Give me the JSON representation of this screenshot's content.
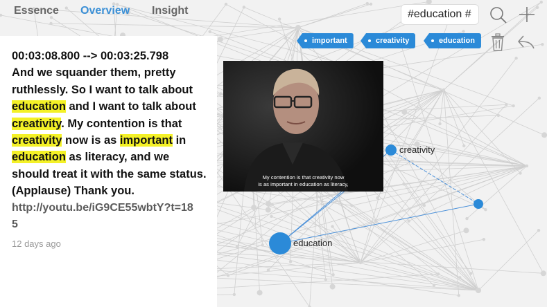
{
  "tabs": [
    {
      "label": "Essence",
      "active": false
    },
    {
      "label": "Overview",
      "active": true
    },
    {
      "label": "Insight",
      "active": false
    }
  ],
  "search": {
    "value": "#education #"
  },
  "toolbar": {
    "search_icon": "magnifier-icon",
    "add_icon": "plus-icon",
    "delete_icon": "trash-icon",
    "reply_icon": "reply-arrow-icon"
  },
  "tags": [
    {
      "label": "important"
    },
    {
      "label": "creativity"
    },
    {
      "label": "education"
    }
  ],
  "statement": {
    "timestamp": "00:03:08.800 --> 00:03:25.798",
    "p1": "And we squander them, pretty ruthlessly. So I want to talk about ",
    "h1": "education",
    "p2": " and I want to talk about ",
    "h2": "creativity",
    "p3": ". My contention is that ",
    "h3": "creativity",
    "p4": " now is as ",
    "h4": "important",
    "p5": " in ",
    "h5": "education",
    "p6": " as literacy, and we should treat it with the same status. (Applause) Thank you.",
    "link": "http://youtu.be/iG9CE55wbtY?t=185",
    "time_ago": "12 days ago"
  },
  "video": {
    "caption_line1": "My contention is that creativity now",
    "caption_line2": "is as important in education as literacy,"
  },
  "graph": {
    "nodes": [
      {
        "label": "creativity"
      },
      {
        "label": "education"
      }
    ]
  },
  "colors": {
    "accent": "#3a8fd6",
    "tag_bg": "#2b8ad8",
    "highlight": "#f4f127",
    "node": "#2b8ad8"
  }
}
